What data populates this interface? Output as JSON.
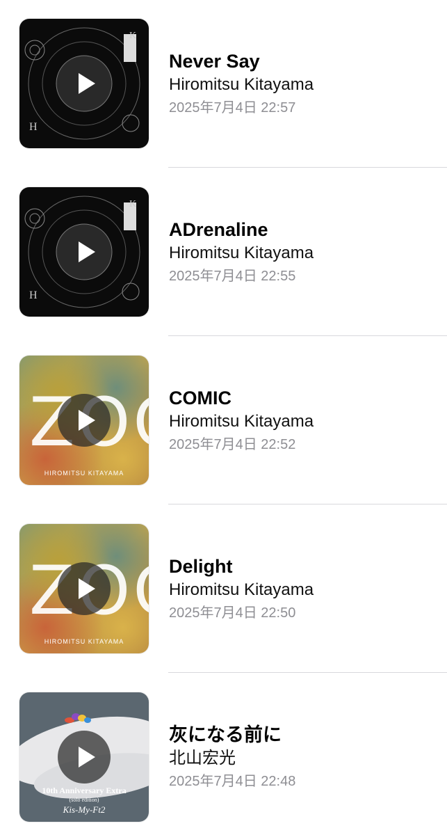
{
  "tracks": [
    {
      "title": "Never Say",
      "artist": "Hiromitsu Kitayama",
      "date": "2025年7月4日 22:57",
      "art": "hamon-dark"
    },
    {
      "title": "ADrenaline",
      "artist": "Hiromitsu Kitayama",
      "date": "2025年7月4日 22:55",
      "art": "hamon-dark"
    },
    {
      "title": "COMIC",
      "artist": "Hiromitsu Kitayama",
      "date": "2025年7月4日 22:52",
      "art": "zoo-colorful"
    },
    {
      "title": "Delight",
      "artist": "Hiromitsu Kitayama",
      "date": "2025年7月4日 22:50",
      "art": "zoo-colorful"
    },
    {
      "title": "灰になる前に",
      "artist": "北山宏光",
      "date": "2025年7月4日 22:48",
      "art": "kismyft2-10th"
    }
  ],
  "album_text": {
    "zoo_title": "ZOO",
    "zoo_sub": "HIROMITSU KITAYAMA",
    "kis_title": "10th Anniversary Extra",
    "kis_edition": "(solo edition)",
    "kis_group": "Kis-My-Ft2"
  },
  "icons": {
    "play": "play-icon"
  }
}
